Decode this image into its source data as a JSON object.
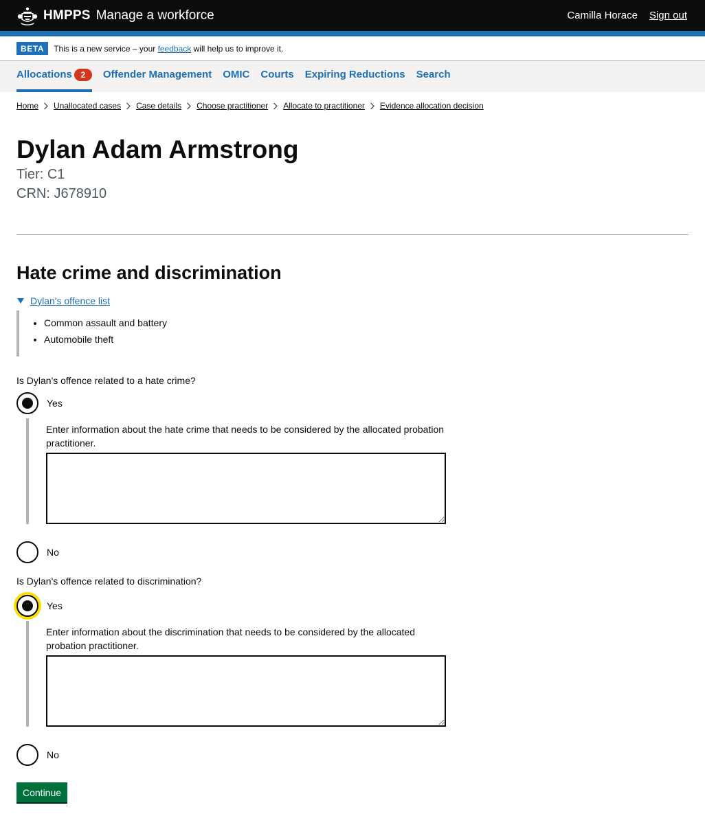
{
  "header": {
    "org": "HMPPS",
    "service": "Manage a workforce",
    "user": "Camilla Horace",
    "sign_out": "Sign out"
  },
  "phase_banner": {
    "tag": "BETA",
    "text_before": "This is a new service – your ",
    "link": "feedback",
    "text_after": " will help us to improve it."
  },
  "nav": {
    "items": [
      {
        "label": "Allocations",
        "badge": "2",
        "active": true
      },
      {
        "label": "Offender Management"
      },
      {
        "label": "OMIC"
      },
      {
        "label": "Courts"
      },
      {
        "label": "Expiring Reductions"
      },
      {
        "label": "Search"
      }
    ]
  },
  "breadcrumbs": [
    "Home",
    "Unallocated cases",
    "Case details",
    "Choose practitioner",
    "Allocate to practitioner",
    "Evidence allocation decision"
  ],
  "person": {
    "name": "Dylan Adam Armstrong",
    "tier": "Tier: C1",
    "crn": "CRN: J678910"
  },
  "section": {
    "heading": "Hate crime and discrimination",
    "details_summary": "Dylan's offence list",
    "offences": [
      "Common assault and battery",
      "Automobile theft"
    ]
  },
  "questions": [
    {
      "label": "Is Dylan's offence related to a hate crime?",
      "yes": "Yes",
      "no": "No",
      "selected": "Yes",
      "hint": "Enter information about the hate crime that needs to be considered by the allocated probation practitioner.",
      "value": ""
    },
    {
      "label": "Is Dylan's offence related to discrimination?",
      "yes": "Yes",
      "no": "No",
      "selected": "Yes",
      "hint": "Enter information about the discrimination that needs to be considered by the allocated probation practitioner.",
      "value": ""
    }
  ],
  "actions": {
    "continue": "Continue"
  },
  "colors": {
    "brand_blue": "#1d70b8",
    "header_black": "#0b0c0c",
    "badge_red": "#d4351c",
    "button_green": "#00703c",
    "focus_yellow": "#ffdd00"
  }
}
